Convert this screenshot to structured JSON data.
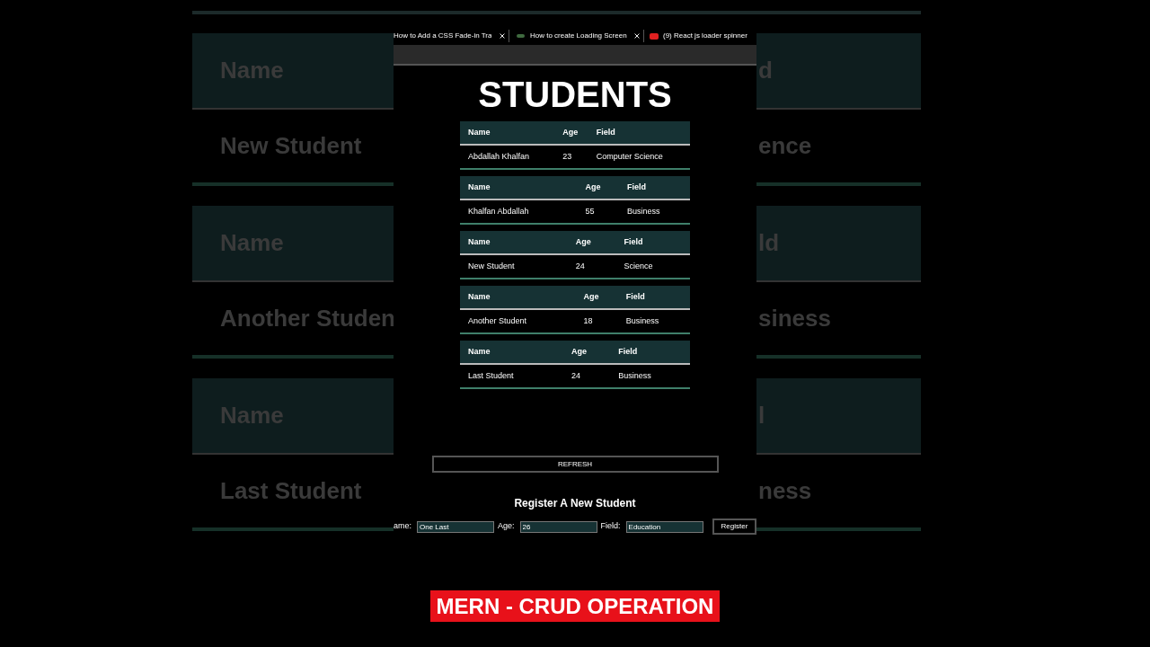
{
  "backdrop": {
    "left": [
      "Name",
      "New Student",
      "Name",
      "Another Studen",
      "Name",
      "Last Student"
    ],
    "right": [
      "d",
      "ence",
      "ld",
      "siness",
      "l",
      "ness"
    ]
  },
  "browser": {
    "tabs": [
      {
        "title": "How to Add a CSS Fade-in Tra",
        "kind": "plain"
      },
      {
        "title": "How to create Loading Screen",
        "kind": "dots"
      },
      {
        "title": "(9) React js loader spinner",
        "kind": "video"
      }
    ]
  },
  "page": {
    "title": "STUDENTS",
    "tables": [
      {
        "columns": [
          "Name",
          "Age",
          "Field"
        ],
        "row": [
          "Abdallah Khalfan",
          "23",
          "Computer Science"
        ]
      },
      {
        "columns": [
          "Name",
          "Age",
          "Field"
        ],
        "row": [
          "Khalfan Abdallah",
          "55",
          "Business"
        ]
      },
      {
        "columns": [
          "Name",
          "Age",
          "Field"
        ],
        "row": [
          "New Student",
          "24",
          "Science"
        ]
      },
      {
        "columns": [
          "Name",
          "Age",
          "Field"
        ],
        "row": [
          "Another Student",
          "18",
          "Business"
        ]
      },
      {
        "columns": [
          "Name",
          "Age",
          "Field"
        ],
        "row": [
          "Last Student",
          "24",
          "Business"
        ]
      }
    ],
    "refresh_button": "REFRESH",
    "form": {
      "heading": "Register A New Student",
      "fields": [
        {
          "label": "ame:",
          "value": "One Last"
        },
        {
          "label": "Age:",
          "value": "26"
        },
        {
          "label": "Field:",
          "value": "Education"
        }
      ],
      "submit": "Register"
    }
  },
  "banner": "MERN - CRUD OPERATION"
}
